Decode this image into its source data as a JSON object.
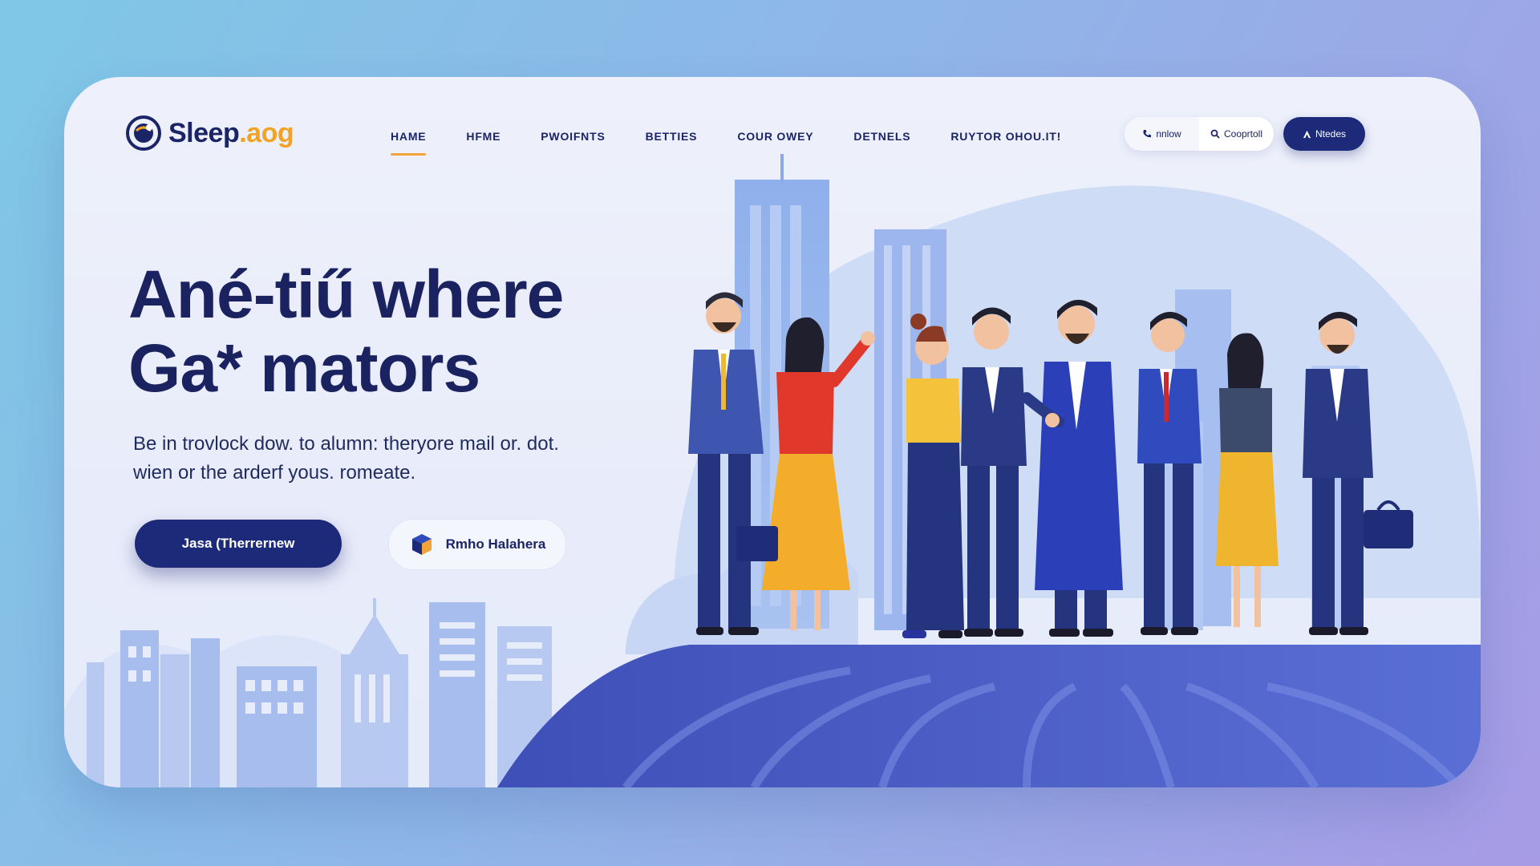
{
  "brand": {
    "name": "Sleep",
    "suffix": ".aog"
  },
  "nav": {
    "items": [
      {
        "label": "HAME"
      },
      {
        "label": "HFME"
      },
      {
        "label": "PWOIFNTS"
      },
      {
        "label": "BETTIES"
      },
      {
        "label": "COUR OWEY"
      },
      {
        "label": "DETNELS"
      },
      {
        "label": "RUYTOR OHOU.IT!"
      }
    ],
    "active_index": 0
  },
  "header_actions": {
    "phone_label": "nnlow",
    "search_label": "Cooprtoll",
    "cta_label": "Ntedes"
  },
  "hero": {
    "headline_line1": "Ané-tiű where",
    "headline_line2": "Ga* mators",
    "subtext_line1": "Be in trovlock dow. to alumn: theryore mail or. dot.",
    "subtext_line2": "wien or the arderf yous. romeate.",
    "primary_button": "Jasa (Therrernew",
    "secondary_button": "Rmho Halahera"
  },
  "colors": {
    "navy": "#1c2a79",
    "accent": "#f0a43a",
    "headline": "#1a2260",
    "building_blue": "#8ea9e6",
    "platform": "#4f5fc9"
  },
  "icons": [
    "globe-logo-icon",
    "phone-icon",
    "search-icon",
    "user-icon",
    "cube-icon"
  ]
}
